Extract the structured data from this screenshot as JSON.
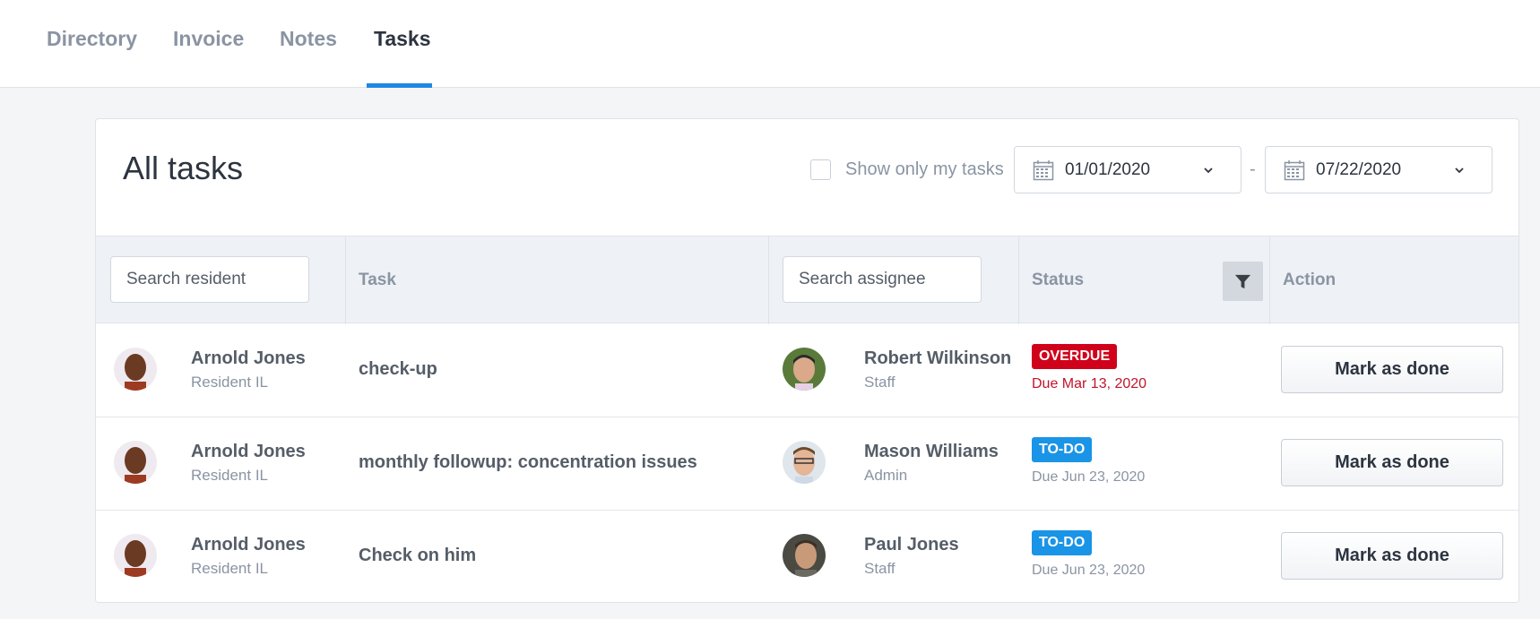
{
  "nav": {
    "tabs": [
      {
        "label": "Directory"
      },
      {
        "label": "Invoice"
      },
      {
        "label": "Notes"
      },
      {
        "label": "Tasks",
        "active": true
      }
    ]
  },
  "page": {
    "title": "All tasks",
    "show_mine_label": "Show only my tasks",
    "show_mine_checked": false,
    "date_from": "01/01/2020",
    "date_separator": "-",
    "date_to": "07/22/2020"
  },
  "table": {
    "headers": {
      "resident_search_placeholder": "Search resident",
      "task": "Task",
      "assignee_search_placeholder": "Search assignee",
      "status": "Status",
      "action": "Action"
    },
    "rows": [
      {
        "resident_name": "Arnold Jones",
        "resident_role": "Resident IL",
        "task": "check-up",
        "assignee_name": "Robert Wilkinson",
        "assignee_role": "Staff",
        "status": "OVERDUE",
        "due": "Due Mar 13, 2020",
        "action": "Mark as done"
      },
      {
        "resident_name": "Arnold Jones",
        "resident_role": "Resident IL",
        "task": "monthly followup: concentration issues",
        "assignee_name": "Mason Williams",
        "assignee_role": "Admin",
        "status": "TO-DO",
        "due": "Due Jun 23, 2020",
        "action": "Mark as done"
      },
      {
        "resident_name": "Arnold Jones",
        "resident_role": "Resident IL",
        "task": "Check on him",
        "assignee_name": "Paul Jones",
        "assignee_role": "Staff",
        "status": "TO-DO",
        "due": "Due Jun 23, 2020",
        "action": "Mark as done"
      }
    ]
  },
  "colors": {
    "accent": "#1e88e5",
    "overdue": "#d0021b",
    "todo": "#1a94e6"
  }
}
